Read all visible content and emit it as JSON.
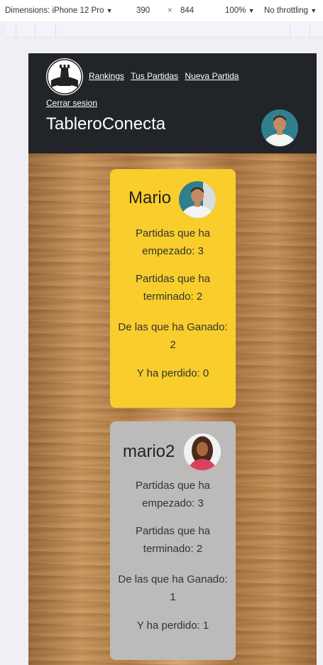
{
  "devtools": {
    "dimensions_label": "Dimensions: iPhone 12 Pro",
    "width": "390",
    "times": "×",
    "height": "844",
    "zoom": "100%",
    "throttling": "No throttling",
    "dropdown_glyph": "▼"
  },
  "nav": {
    "links": [
      "Rankings",
      "Tus Partidas",
      "Nueva Partida"
    ],
    "logout": "Cerrar sesion",
    "brand": "TableroConecta"
  },
  "players": [
    {
      "name": "Mario",
      "stats": [
        "Partidas que ha empezado: 3",
        "Partidas que ha terminado: 2",
        "De las que ha Ganado: 2",
        "Y ha perdido: 0"
      ]
    },
    {
      "name": "mario2",
      "stats": [
        "Partidas que ha empezado: 3",
        "Partidas que ha terminado: 2",
        "De las que ha Ganado: 1",
        "Y ha perdido: 1"
      ]
    }
  ],
  "colors": {
    "navbar": "#212529",
    "card_yellow": "#f9cd2c",
    "card_gray": "#bcbbb9"
  },
  "icons": [
    "chess-logo-icon",
    "male-avatar",
    "female-avatar"
  ]
}
